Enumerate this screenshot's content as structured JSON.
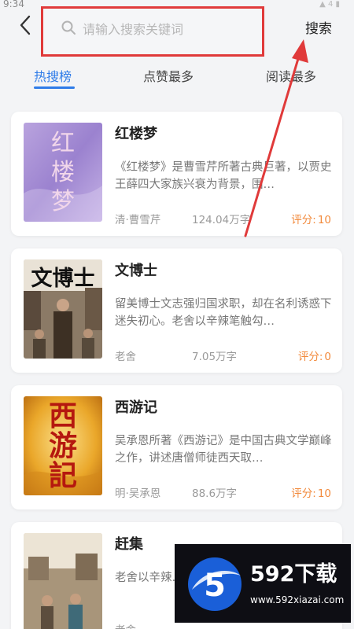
{
  "status": {
    "time": "9:34",
    "indicators": "▲ 4 ▮"
  },
  "search": {
    "placeholder": "请输入搜索关键词",
    "value": "",
    "button_label": "搜索"
  },
  "tabs": [
    {
      "label": "热搜榜",
      "active": true
    },
    {
      "label": "点赞最多",
      "active": false
    },
    {
      "label": "阅读最多",
      "active": false
    }
  ],
  "books": [
    {
      "title": "红楼梦",
      "description": "《红楼梦》是曹雪芹所著古典巨著，以贾史王薛四大家族兴衰为背景，围…",
      "author": "清·曹雪芹",
      "words": "124.04万字",
      "score_label": "评分:",
      "score": "10",
      "cover_text": "红楼梦"
    },
    {
      "title": "文博士",
      "description": "留美博士文志强归国求职，却在名利诱惑下迷失初心。老舍以辛辣笔触勾…",
      "author": "老舍",
      "words": "7.05万字",
      "score_label": "评分:",
      "score": "0",
      "cover_text": "文博士"
    },
    {
      "title": "西游记",
      "description": "吴承恩所著《西游记》是中国古典文学巅峰之作，讲述唐僧师徒西天取…",
      "author": "明·吴承恩",
      "words": "88.6万字",
      "score_label": "评分:",
      "score": "10",
      "cover_text": "西游記"
    },
    {
      "title": "赶集",
      "description": "老舍以辛辣…民烟火日常…",
      "author": "老舍",
      "words": "",
      "score_label": "",
      "score": "",
      "cover_text": ""
    }
  ],
  "watermark": {
    "brand": "592下载",
    "url": "www.592xiazai.com",
    "logo_text": "5"
  },
  "colors": {
    "accent": "#2f7ce8",
    "score": "#f28a3c",
    "highlight_box": "#e03a3a",
    "arrow": "#e03a3a"
  },
  "icons": {
    "back": "chevron-left-icon",
    "search": "magnifier-icon"
  }
}
